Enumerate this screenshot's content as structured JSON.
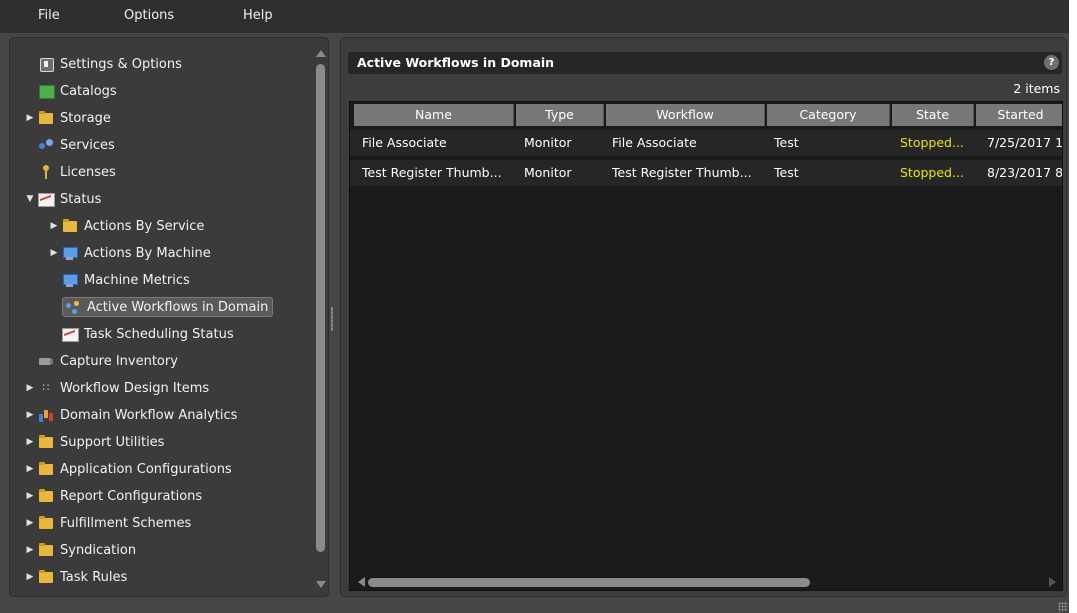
{
  "menu": {
    "file": "File",
    "options": "Options",
    "help": "Help"
  },
  "tree": {
    "items": [
      {
        "label": "Settings & Options",
        "icon": "gear-icon"
      },
      {
        "label": "Catalogs",
        "icon": "book-icon"
      },
      {
        "label": "Storage",
        "icon": "folder-icon",
        "expandable": true
      },
      {
        "label": "Services",
        "icon": "services-icon"
      },
      {
        "label": "Licenses",
        "icon": "key-icon"
      },
      {
        "label": "Status",
        "icon": "chart-icon",
        "expanded": true
      },
      {
        "label": "Actions By Service",
        "icon": "folder-icon",
        "expandable": true
      },
      {
        "label": "Actions By Machine",
        "icon": "computer-icon",
        "expandable": true
      },
      {
        "label": "Machine Metrics",
        "icon": "computer-icon"
      },
      {
        "label": "Active Workflows in Domain",
        "icon": "workflow-icon",
        "selected": true
      },
      {
        "label": "Task Scheduling Status",
        "icon": "chart-icon"
      },
      {
        "label": "Capture Inventory",
        "icon": "camera-icon"
      },
      {
        "label": "Workflow Design Items",
        "icon": "design-icon",
        "expandable": true
      },
      {
        "label": "Domain Workflow Analytics",
        "icon": "analytics-icon",
        "expandable": true
      },
      {
        "label": "Support Utilities",
        "icon": "folder-icon",
        "expandable": true
      },
      {
        "label": "Application Configurations",
        "icon": "folder-icon",
        "expandable": true
      },
      {
        "label": "Report Configurations",
        "icon": "folder-icon",
        "expandable": true
      },
      {
        "label": "Fulfillment Schemes",
        "icon": "folder-icon",
        "expandable": true
      },
      {
        "label": "Syndication",
        "icon": "folder-icon",
        "expandable": true
      },
      {
        "label": "Task Rules",
        "icon": "folder-icon",
        "expandable": true
      }
    ]
  },
  "panel": {
    "title": "Active Workflows in Domain",
    "help": "?",
    "item_count": "2 items"
  },
  "grid": {
    "columns": [
      "Name",
      "Type",
      "Workflow",
      "Category",
      "State",
      "Started"
    ],
    "rows": [
      [
        "File Associate",
        "Monitor",
        "File Associate",
        "Test",
        "Stopped...",
        "7/25/2017 1"
      ],
      [
        "Test Register Thumb...",
        "Monitor",
        "Test Register Thumb...",
        "Test",
        "Stopped...",
        "8/23/2017 8"
      ]
    ]
  },
  "colors": {
    "state_stopped": "#e6e600",
    "background": "#464646"
  }
}
